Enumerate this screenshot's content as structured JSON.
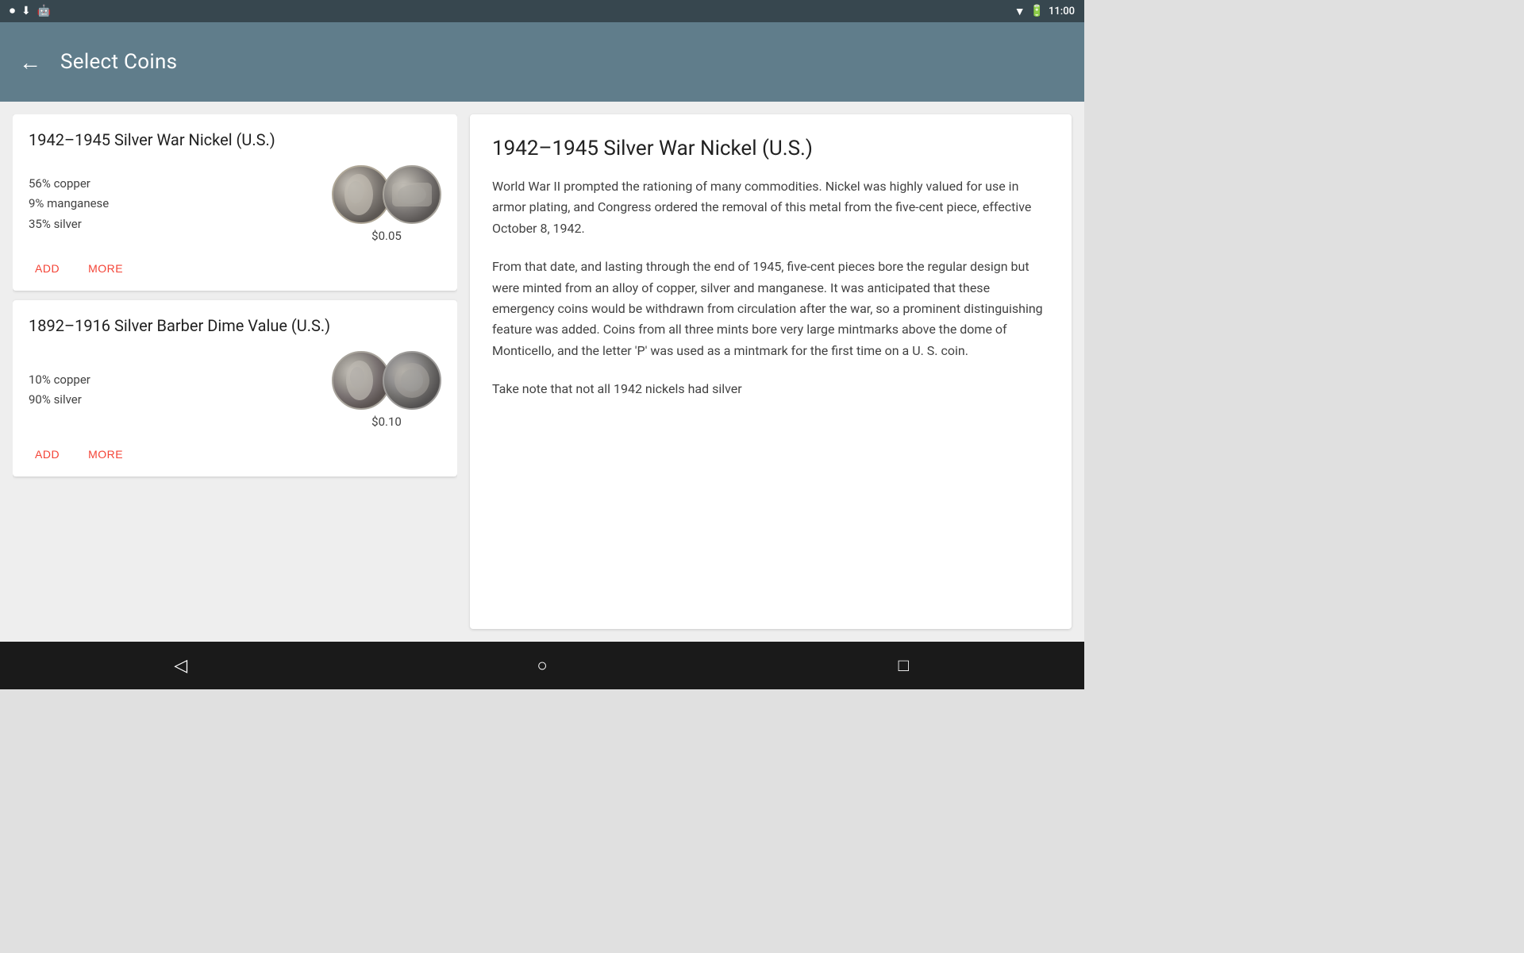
{
  "statusBar": {
    "time": "11:00",
    "icons": [
      "record-icon",
      "download-icon",
      "android-icon"
    ]
  },
  "appBar": {
    "title": "Select Coins",
    "backLabel": "←"
  },
  "coins": [
    {
      "id": "war-nickel",
      "title": "1942–1945 Silver War Nickel (U.S.)",
      "composition": [
        "56% copper",
        "9% manganese",
        "35% silver"
      ],
      "price": "$0.05",
      "addLabel": "ADD",
      "moreLabel": "MORE"
    },
    {
      "id": "barber-dime",
      "title": "1892–1916 Silver Barber Dime Value (U.S.)",
      "composition": [
        "10% copper",
        "90% silver"
      ],
      "price": "$0.10",
      "addLabel": "ADD",
      "moreLabel": "MORE"
    }
  ],
  "detail": {
    "title": "1942–1945 Silver War Nickel (U.S.)",
    "paragraphs": [
      "World War II prompted the rationing of many commodities. Nickel was highly valued for use in armor plating, and Congress ordered the removal of this metal from the five-cent piece, effective October 8, 1942.",
      "From that date, and lasting through the end of 1945, five-cent pieces bore the regular design but were minted from an alloy of copper, silver and manganese. It was anticipated that these emergency coins would be withdrawn from circulation after the war, so a prominent distinguishing feature was added. Coins from all three mints bore very large mintmarks above the dome of Monticello, and the letter 'P' was used as a mintmark for the first time on a U. S. coin.",
      "Take note that not all 1942 nickels had silver"
    ]
  },
  "navBar": {
    "backSymbol": "◁",
    "homeSymbol": "○",
    "recentSymbol": "□"
  }
}
